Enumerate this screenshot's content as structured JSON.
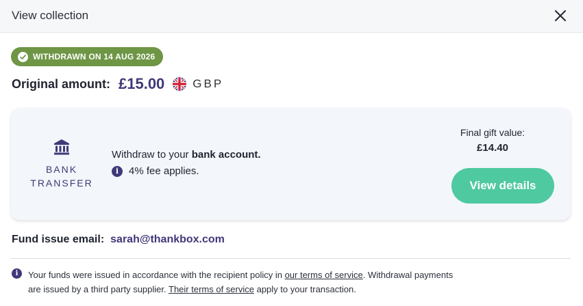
{
  "header": {
    "title": "View collection",
    "close_icon": "close-icon"
  },
  "status_badge": {
    "text": "WITHDRAWN ON 14 AUG 2026",
    "color": "#6e9645",
    "icon": "check-circle-icon"
  },
  "original": {
    "label": "Original amount:",
    "amount": "£15.00",
    "flag_icon": "uk-flag-icon",
    "currency": "GBP"
  },
  "method_card": {
    "icon": "bank-icon",
    "method_line1": "BANK",
    "method_line2": "TRANSFER",
    "withdraw_prefix": "Withdraw to your ",
    "withdraw_bold": "bank account.",
    "fee_text": "4% fee applies.",
    "final_label": "Final gift value:",
    "final_value": "£14.40",
    "button_label": "View details",
    "button_color": "#4fc9a0"
  },
  "fund_issue": {
    "label": "Fund issue email:",
    "email": "sarah@thankbox.com"
  },
  "notice": {
    "part1": "Your funds were issued in accordance with the recipient policy in ",
    "link1": "our terms of service",
    "part2": ". Withdrawal payments are issued by a third party supplier. ",
    "link2": "Their terms of service",
    "part3": " apply to your transaction."
  },
  "colors": {
    "accent_purple": "#3f3879",
    "card_bg": "#f3f6fa"
  }
}
